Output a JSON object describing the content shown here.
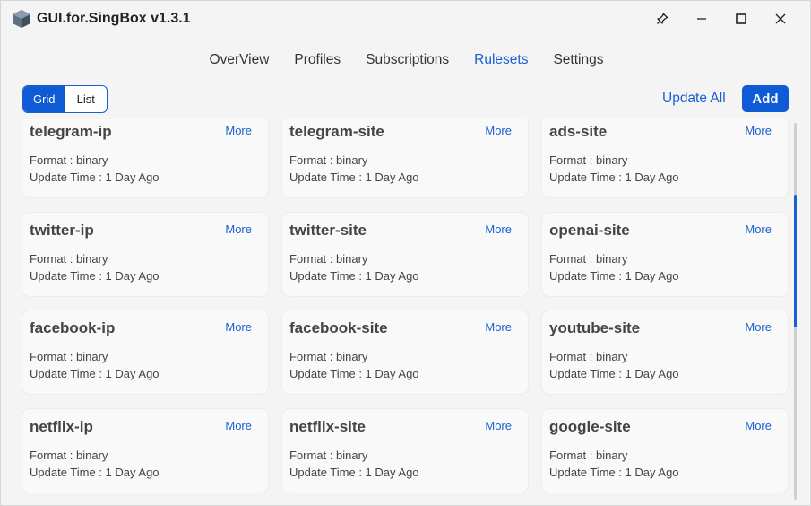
{
  "window": {
    "title": "GUI.for.SingBox v1.3.1"
  },
  "nav": {
    "items": [
      {
        "label": "OverView"
      },
      {
        "label": "Profiles"
      },
      {
        "label": "Subscriptions"
      },
      {
        "label": "Rulesets"
      },
      {
        "label": "Settings"
      }
    ],
    "active": "Rulesets"
  },
  "toolbar": {
    "view_grid": "Grid",
    "view_list": "List",
    "active_view": "Grid",
    "update_all": "Update All",
    "add": "Add"
  },
  "rulesets": [
    {
      "name": "telegram-ip",
      "more": "More",
      "format": "Format : binary",
      "update": "Update Time : 1 Day Ago"
    },
    {
      "name": "telegram-site",
      "more": "More",
      "format": "Format : binary",
      "update": "Update Time : 1 Day Ago"
    },
    {
      "name": "ads-site",
      "more": "More",
      "format": "Format : binary",
      "update": "Update Time : 1 Day Ago"
    },
    {
      "name": "twitter-ip",
      "more": "More",
      "format": "Format : binary",
      "update": "Update Time : 1 Day Ago"
    },
    {
      "name": "twitter-site",
      "more": "More",
      "format": "Format : binary",
      "update": "Update Time : 1 Day Ago"
    },
    {
      "name": "openai-site",
      "more": "More",
      "format": "Format : binary",
      "update": "Update Time : 1 Day Ago"
    },
    {
      "name": "facebook-ip",
      "more": "More",
      "format": "Format : binary",
      "update": "Update Time : 1 Day Ago"
    },
    {
      "name": "facebook-site",
      "more": "More",
      "format": "Format : binary",
      "update": "Update Time : 1 Day Ago"
    },
    {
      "name": "youtube-site",
      "more": "More",
      "format": "Format : binary",
      "update": "Update Time : 1 Day Ago"
    },
    {
      "name": "netflix-ip",
      "more": "More",
      "format": "Format : binary",
      "update": "Update Time : 1 Day Ago"
    },
    {
      "name": "netflix-site",
      "more": "More",
      "format": "Format : binary",
      "update": "Update Time : 1 Day Ago"
    },
    {
      "name": "google-site",
      "more": "More",
      "format": "Format : binary",
      "update": "Update Time : 1 Day Ago"
    }
  ],
  "icons": {
    "logo": "app-logo-icon",
    "pin": "pin-icon",
    "minimize": "minimize-icon",
    "maximize": "maximize-icon",
    "close": "close-icon"
  },
  "colors": {
    "accent": "#0f5bd6",
    "link": "#1a5fd1",
    "card_bg": "#f9f9f9",
    "window_bg": "#f4f4f4"
  }
}
